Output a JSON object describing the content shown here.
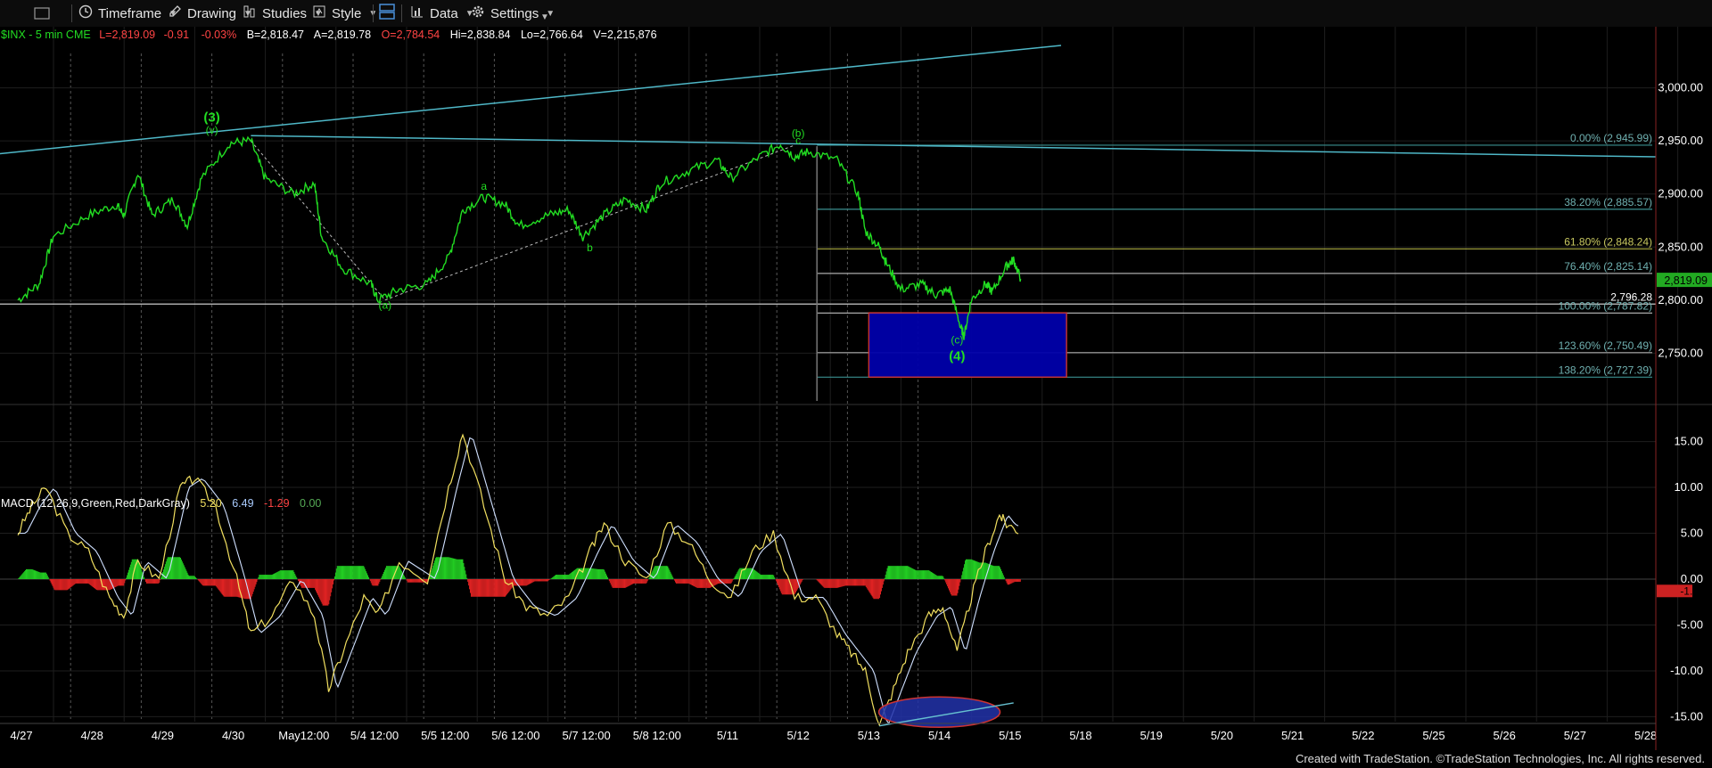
{
  "toolbar": {
    "timeframe": "Timeframe",
    "drawing": "Drawing",
    "studies": "Studies",
    "style": "Style",
    "data": "Data",
    "settings": "Settings"
  },
  "header": {
    "symbol": "$INX - 5 min  CME",
    "last": "L=2,819.09",
    "chg": "-0.91",
    "pct": "-0.03%",
    "bid": "B=2,818.47",
    "ask": "A=2,819.78",
    "open": "O=2,784.54",
    "high": "Hi=2,838.84",
    "low": "Lo=2,766.64",
    "vol": "V=2,215,876"
  },
  "macd_header": {
    "name": "MACD (12,26,9,Green,Red,DarkGray)",
    "v1": "5.20",
    "v2": "6.49",
    "v3": "-1.29",
    "v4": "0.00"
  },
  "footer": "Created with TradeStation. ©TradeStation Technologies, Inc. All rights reserved.",
  "colors": {
    "price": "#22dd22",
    "trend": "#4fb8c8",
    "fib_teal": "#3a8f8f",
    "fib_olive": "#9a9a3a",
    "fib_gray": "#aaaaaa",
    "macd": "#f2e060",
    "signal": "#ffffff",
    "hist_pos": "#22cc22",
    "hist_neg": "#dd2222",
    "box": "#0000aa",
    "box_border": "#cc3333"
  },
  "chart_data": [
    {
      "type": "line",
      "title": "$INX - 5 min",
      "x_ticks": [
        "4/27",
        "4/28",
        "4/29",
        "4/30",
        "May12:00",
        "5/4 12:00",
        "5/5 12:00",
        "5/6 12:00",
        "5/7 12:00",
        "5/8 12:00",
        "5/11",
        "5/12",
        "5/13",
        "5/14",
        "5/15",
        "5/18",
        "5/19",
        "5/20",
        "5/21",
        "5/22",
        "5/25",
        "5/26",
        "5/27",
        "5/28"
      ],
      "y_ticks": [
        "3,000.00",
        "2,950.00",
        "2,900.00",
        "2,850.00",
        "2,800.00",
        "2,750.00"
      ],
      "ylim": [
        2705,
        3045
      ],
      "last_price": "2,819.09",
      "series": [
        {
          "values": [
            [
              0,
              2800
            ],
            [
              0.3,
              2815
            ],
            [
              0.5,
              2860
            ],
            [
              1,
              2880
            ],
            [
              1.4,
              2890
            ],
            [
              1.5,
              2880
            ],
            [
              1.7,
              2920
            ],
            [
              1.9,
              2880
            ],
            [
              2.2,
              2895
            ],
            [
              2.4,
              2870
            ],
            [
              2.6,
              2915
            ],
            [
              3.0,
              2948
            ],
            [
              3.3,
              2950
            ],
            [
              3.5,
              2915
            ],
            [
              3.9,
              2900
            ],
            [
              4.2,
              2910
            ],
            [
              4.3,
              2860
            ],
            [
              4.6,
              2830
            ],
            [
              5.0,
              2815
            ],
            [
              5.1,
              2800
            ],
            [
              5.4,
              2810
            ],
            [
              5.8,
              2815
            ],
            [
              6.1,
              2840
            ],
            [
              6.3,
              2885
            ],
            [
              6.6,
              2897
            ],
            [
              6.9,
              2890
            ],
            [
              7.1,
              2870
            ],
            [
              7.5,
              2880
            ],
            [
              7.8,
              2885
            ],
            [
              8.0,
              2860
            ],
            [
              8.3,
              2880
            ],
            [
              8.6,
              2895
            ],
            [
              8.9,
              2885
            ],
            [
              9.1,
              2910
            ],
            [
              9.5,
              2922
            ],
            [
              9.9,
              2932
            ],
            [
              10.1,
              2915
            ],
            [
              10.5,
              2935
            ],
            [
              10.8,
              2947
            ],
            [
              11.0,
              2935
            ],
            [
              11.2,
              2940
            ],
            [
              11.6,
              2932
            ],
            [
              11.9,
              2900
            ],
            [
              12.0,
              2865
            ],
            [
              12.2,
              2850
            ],
            [
              12.3,
              2835
            ],
            [
              12.5,
              2810
            ],
            [
              12.8,
              2815
            ],
            [
              13.0,
              2805
            ],
            [
              13.2,
              2810
            ],
            [
              13.35,
              2775
            ],
            [
              13.4,
              2766
            ],
            [
              13.5,
              2800
            ],
            [
              13.7,
              2815
            ],
            [
              13.8,
              2808
            ],
            [
              14.0,
              2832
            ],
            [
              14.1,
              2838
            ],
            [
              14.2,
              2820
            ]
          ],
          "annotations": [
            {
              "x": 3.0,
              "y": 2968,
              "text": "(3)"
            },
            {
              "x": 3.0,
              "y": 2957,
              "text": "(v)"
            },
            {
              "x": 5.2,
              "y": 2792,
              "text": "(a)"
            },
            {
              "x": 6.6,
              "y": 2904,
              "text": "a"
            },
            {
              "x": 8.1,
              "y": 2846,
              "text": "b"
            },
            {
              "x": 11.05,
              "y": 2954,
              "text": "(b)"
            },
            {
              "x": 11.05,
              "y": 2947,
              "text": "c"
            },
            {
              "x": 13.3,
              "y": 2759,
              "text": "(c)"
            },
            {
              "x": 13.3,
              "y": 2743,
              "text": "(4)"
            }
          ]
        }
      ],
      "fib_levels": [
        {
          "label": "0.00% (2,945.99)",
          "value": 2945.99
        },
        {
          "label": "38.20% (2,885.57)",
          "value": 2885.57
        },
        {
          "label": "61.80% (2,848.24)",
          "value": 2848.24
        },
        {
          "label": "76.40% (2,825.14)",
          "value": 2825.14
        },
        {
          "label": "2,796.28",
          "value": 2796.28
        },
        {
          "label": "100.00% (2,787.82)",
          "value": 2787.82
        },
        {
          "label": "123.60% (2,750.49)",
          "value": 2750.49
        },
        {
          "label": "138.20% (2,727.39)",
          "value": 2727.39
        }
      ],
      "target_box": {
        "x0": 12.05,
        "x1": 14.85,
        "y0": 2727.39,
        "y1": 2788
      }
    },
    {
      "type": "line",
      "title": "MACD (12,26,9,Green,Red,DarkGray)",
      "y_ticks": [
        "15.00",
        "10.00",
        "5.00",
        "0.00",
        "-5.00",
        "-10.00",
        "-15.00"
      ],
      "ylim": [
        -17,
        17
      ],
      "last_value": "-1.29",
      "series": [
        {
          "values": [
            [
              0,
              5
            ],
            [
              0.2,
              8
            ],
            [
              0.4,
              10
            ],
            [
              0.7,
              5
            ],
            [
              1.0,
              3
            ],
            [
              1.3,
              -2
            ],
            [
              1.5,
              -4
            ],
            [
              1.7,
              2
            ],
            [
              2.0,
              0
            ],
            [
              2.3,
              10
            ],
            [
              2.5,
              11
            ],
            [
              2.8,
              8
            ],
            [
              3.1,
              0
            ],
            [
              3.3,
              -6
            ],
            [
              3.6,
              -4
            ],
            [
              3.9,
              0
            ],
            [
              4.2,
              -4
            ],
            [
              4.4,
              -12
            ],
            [
              4.6,
              -8
            ],
            [
              4.9,
              -2
            ],
            [
              5.1,
              -4
            ],
            [
              5.4,
              2
            ],
            [
              5.8,
              0
            ],
            [
              6.1,
              10
            ],
            [
              6.3,
              16
            ],
            [
              6.6,
              8
            ],
            [
              6.9,
              0
            ],
            [
              7.2,
              -3
            ],
            [
              7.5,
              -4
            ],
            [
              7.8,
              -2
            ],
            [
              8.1,
              3
            ],
            [
              8.3,
              6
            ],
            [
              8.6,
              2
            ],
            [
              8.9,
              0
            ],
            [
              9.2,
              6
            ],
            [
              9.5,
              4
            ],
            [
              9.8,
              0
            ],
            [
              10.1,
              -2
            ],
            [
              10.4,
              3
            ],
            [
              10.7,
              5
            ],
            [
              11.0,
              -2
            ],
            [
              11.3,
              -2
            ],
            [
              11.6,
              -6
            ],
            [
              11.8,
              -8
            ],
            [
              12.0,
              -10
            ],
            [
              12.2,
              -16
            ],
            [
              12.4,
              -12
            ],
            [
              12.6,
              -8
            ],
            [
              12.9,
              -4
            ],
            [
              13.1,
              -3
            ],
            [
              13.3,
              -8
            ],
            [
              13.5,
              -2
            ],
            [
              13.7,
              3
            ],
            [
              13.9,
              7
            ],
            [
              14.0,
              6
            ],
            [
              14.2,
              5.2
            ]
          ]
        }
      ]
    }
  ]
}
